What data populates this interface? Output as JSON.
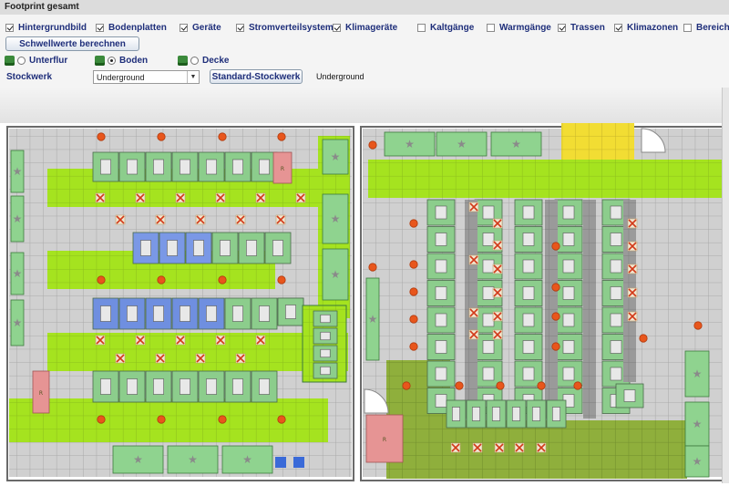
{
  "window": {
    "title": "Footprint gesamt"
  },
  "layers": [
    {
      "label": "Hintergrundbild",
      "checked": true
    },
    {
      "label": "Bodenplatten",
      "checked": true
    },
    {
      "label": "Geräte",
      "checked": true
    },
    {
      "label": "Stromverteilsysteme",
      "checked": true
    },
    {
      "label": "Klimageräte",
      "checked": true
    },
    {
      "label": "Kaltgänge",
      "checked": false
    },
    {
      "label": "Warmgänge",
      "checked": false
    },
    {
      "label": "Trassen",
      "checked": true
    },
    {
      "label": "Klimazonen",
      "checked": true
    },
    {
      "label": "Bereiche",
      "checked": false
    }
  ],
  "buttons": {
    "thresholds": "Schwellwerte berechnen",
    "standard_floor": "Standard-Stockwerk"
  },
  "levels": [
    {
      "label": "Unterflur",
      "selected": false
    },
    {
      "label": "Boden",
      "selected": true
    },
    {
      "label": "Decke",
      "selected": false
    }
  ],
  "floor": {
    "label": "Stockwerk",
    "selected": "Underground",
    "current": "Underground"
  },
  "plan_labels": {
    "rack_marker": "R",
    "door": "Tür"
  },
  "colors": {
    "floor_green": "#a3e21d",
    "floor_grey": "#cfcfcf",
    "warm_zone": "#8fae3d",
    "hot_zone": "#f2dd33",
    "rack_blue": "#6f8fe0",
    "rack_green": "#7ccf7c",
    "power_pink": "#e49090",
    "ac_unit": "#3d9a3d"
  }
}
